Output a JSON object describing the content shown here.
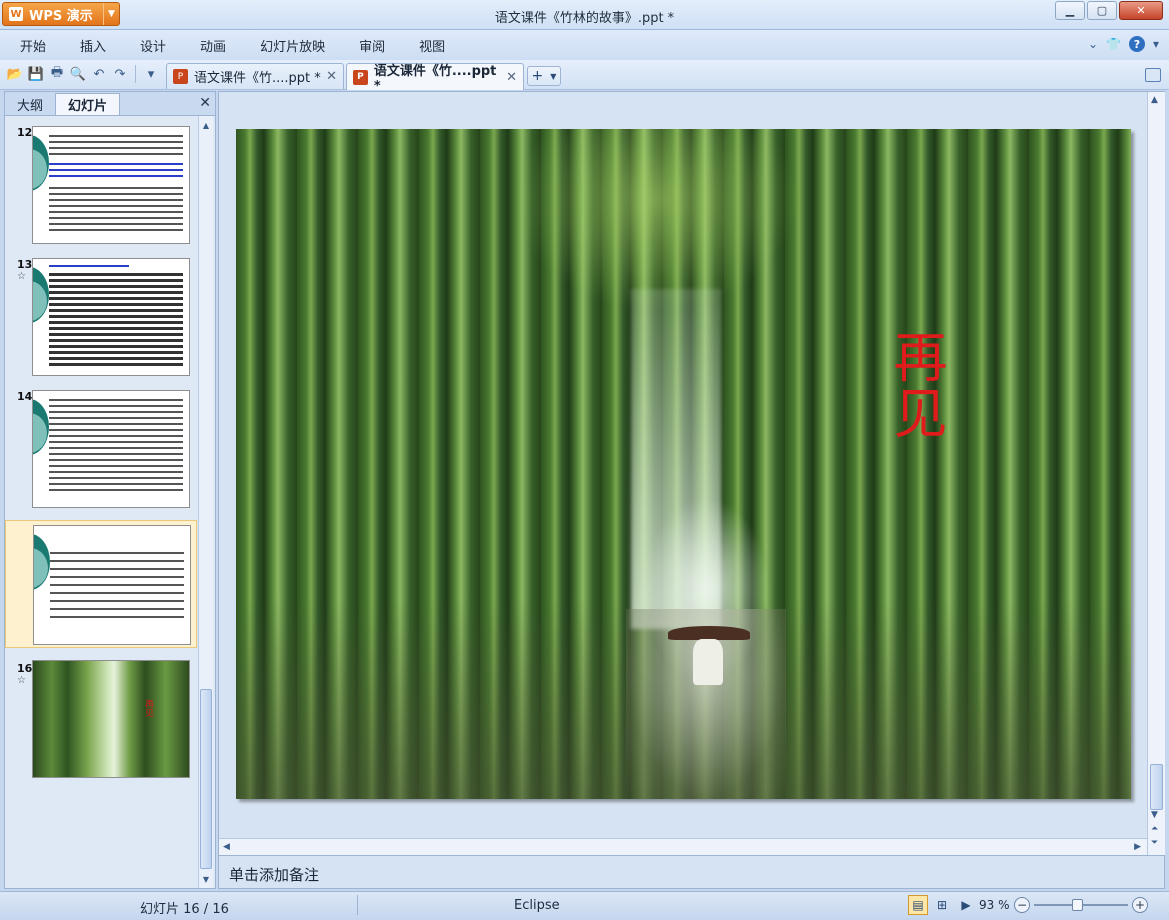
{
  "app": {
    "button_label": "WPS 演示",
    "logo_icon": "wps-logo-icon"
  },
  "window": {
    "title": "语文课件《竹林的故事》.ppt *"
  },
  "menu": {
    "items": [
      "开始",
      "插入",
      "设计",
      "动画",
      "幻灯片放映",
      "审阅",
      "视图"
    ]
  },
  "doc_tabs": [
    {
      "label": "语文课件《竹....ppt *",
      "active": false
    },
    {
      "label": "语文课件《竹....ppt *",
      "active": true
    }
  ],
  "left_pane": {
    "tabs": [
      "大纲",
      "幻灯片"
    ],
    "active_tab": "幻灯片",
    "slides": [
      {
        "number": "12",
        "star": ""
      },
      {
        "number": "13",
        "star": "☆"
      },
      {
        "number": "14",
        "star": ""
      },
      {
        "number": "",
        "star": "",
        "selected": true
      },
      {
        "number": "16",
        "star": "☆",
        "caption": "再见"
      }
    ]
  },
  "slide": {
    "caption": "再见"
  },
  "notes": {
    "placeholder": "单击添加备注"
  },
  "status": {
    "slide_info": "幻灯片 16 / 16",
    "theme": "Eclipse",
    "zoom": "93 %",
    "zoom_level": 0.45
  },
  "colors": {
    "accent_orange": "#e2741b",
    "caption_red": "#e01b1b",
    "chrome_blue": "#c5d7ee"
  }
}
